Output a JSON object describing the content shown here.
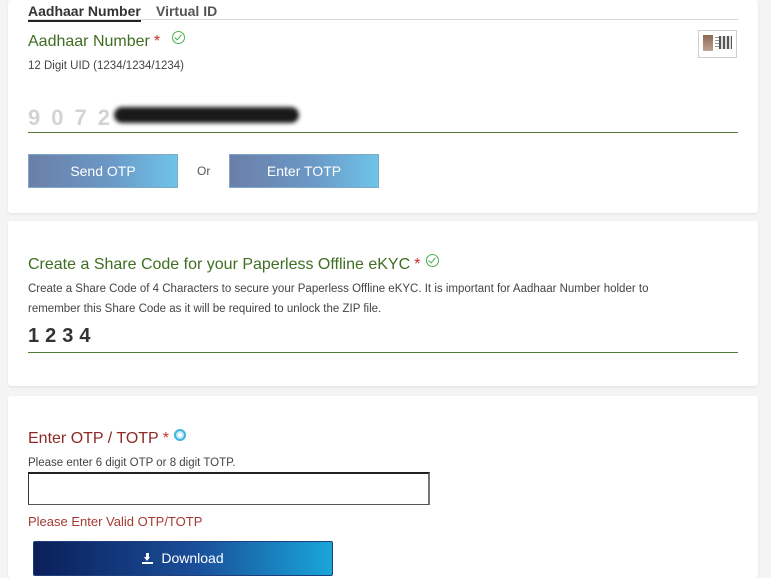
{
  "tabs": [
    {
      "label": "Aadhaar Number",
      "active": true
    },
    {
      "label": "Virtual ID",
      "active": false
    }
  ],
  "aadhaar": {
    "label": "Aadhaar Number",
    "required_mark": "*",
    "hint": "12 Digit UID (1234/1234/1234)",
    "value_visible": "9072",
    "valid": true
  },
  "buttons": {
    "send_otp": "Send OTP",
    "or": "Or",
    "enter_totp": "Enter TOTP",
    "download": "Download"
  },
  "share_code": {
    "label": "Create a Share Code for your Paperless Offline eKYC",
    "required_mark": "*",
    "hint_line1": "Create a Share Code of 4 Characters to secure your Paperless Offline eKYC. It is important for Aadhaar Number holder to",
    "hint_line2": "remember this Share Code as it will be required to unlock the ZIP file.",
    "value": "1234",
    "valid": true
  },
  "otp": {
    "label": "Enter OTP / TOTP",
    "required_mark": "*",
    "hint": "Please enter 6 digit OTP or 8 digit TOTP.",
    "value": "",
    "error": "Please Enter Valid OTP/TOTP"
  },
  "colors": {
    "label_green": "#3f6e22",
    "label_red": "#8c2b25",
    "field_underline": "#4e7d3a",
    "check": "#4caf50",
    "download_dark": "#0b1f5a",
    "download_light": "#1aa6d9"
  },
  "icons": [
    "check-circle-icon",
    "aadhaar-card-thumbnail",
    "radio-icon",
    "download-icon"
  ]
}
